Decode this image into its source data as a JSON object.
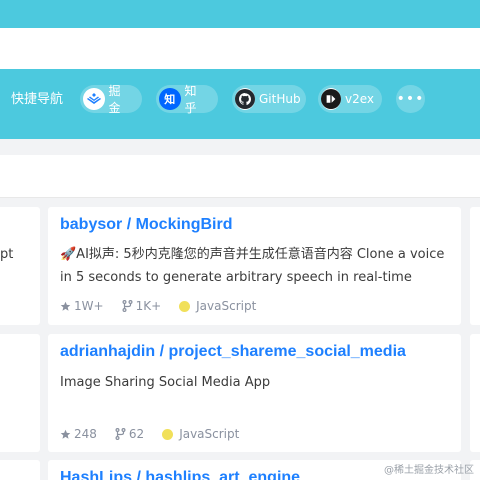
{
  "nav": {
    "label": "快捷导航",
    "items": [
      {
        "label": "掘金",
        "icon": "juejin-icon"
      },
      {
        "label": "知乎",
        "icon": "zhihu-icon",
        "icon_text": "知"
      },
      {
        "label": "GitHub",
        "icon": "github-icon"
      },
      {
        "label": "v2ex",
        "icon": "v2ex-icon"
      }
    ],
    "more": "•••"
  },
  "left_fragment": "pt",
  "repos": [
    {
      "title": "babysor / MockingBird",
      "description": "🚀AI拟声: 5秒内克隆您的声音并生成任意语音内容 Clone a voice in 5 seconds to generate arbitrary speech in real-time",
      "stars": "1W+",
      "forks": "1K+",
      "language": "JavaScript"
    },
    {
      "title": "adrianhajdin / project_shareme_social_media",
      "description": "Image Sharing Social Media App",
      "stars": "248",
      "forks": "62",
      "language": "JavaScript"
    },
    {
      "title": "HashLips / hashlips_art_engine",
      "description": "",
      "stars": "",
      "forks": "",
      "language": ""
    }
  ],
  "colors": {
    "accent": "#4cc9de",
    "link": "#1e80ff",
    "language_javascript": "#f1e05a"
  },
  "watermark": "@稀土掘金技术社区"
}
